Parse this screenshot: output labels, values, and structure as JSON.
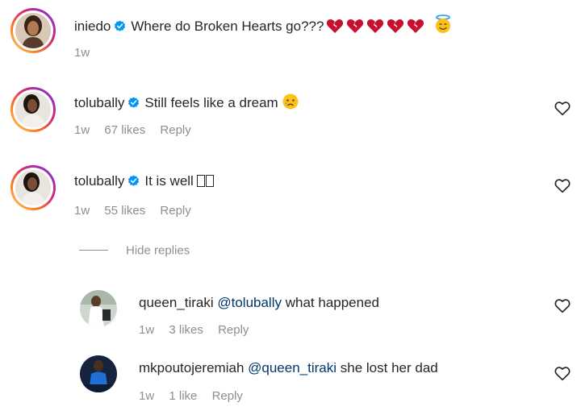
{
  "comments": [
    {
      "username": "iniedo",
      "text": "Where do Broken Hearts go???",
      "emoji_names": [
        "broken-heart-icon",
        "broken-heart-icon",
        "broken-heart-icon",
        "broken-heart-icon",
        "broken-heart-icon",
        "smiling-face-with-halo-icon"
      ],
      "time": "1w"
    },
    {
      "username": "tolubally",
      "text": "Still feels like a dream",
      "emoji_names": [
        "sad-face-with-tear-icon"
      ],
      "time": "1w",
      "likes": "67 likes",
      "reply": "Reply"
    },
    {
      "username": "tolubally",
      "text": "It is well",
      "time": "1w",
      "likes": "55 likes",
      "reply": "Reply"
    }
  ],
  "hide_replies": "Hide replies",
  "replies": [
    {
      "username": "queen_tiraki",
      "mention": "@tolubally",
      "text": "what happened",
      "time": "1w",
      "likes": "3 likes",
      "reply": "Reply"
    },
    {
      "username": "mkpoutojeremiah",
      "mention": "@queen_tiraki",
      "text": "she lost her dad",
      "time": "1w",
      "likes": "1 like",
      "reply": "Reply"
    }
  ],
  "colors": {
    "verified": "#0095f6",
    "heart_emoji": "#c8102e",
    "mention": "#00376b",
    "meta": "#8e8e8e"
  }
}
